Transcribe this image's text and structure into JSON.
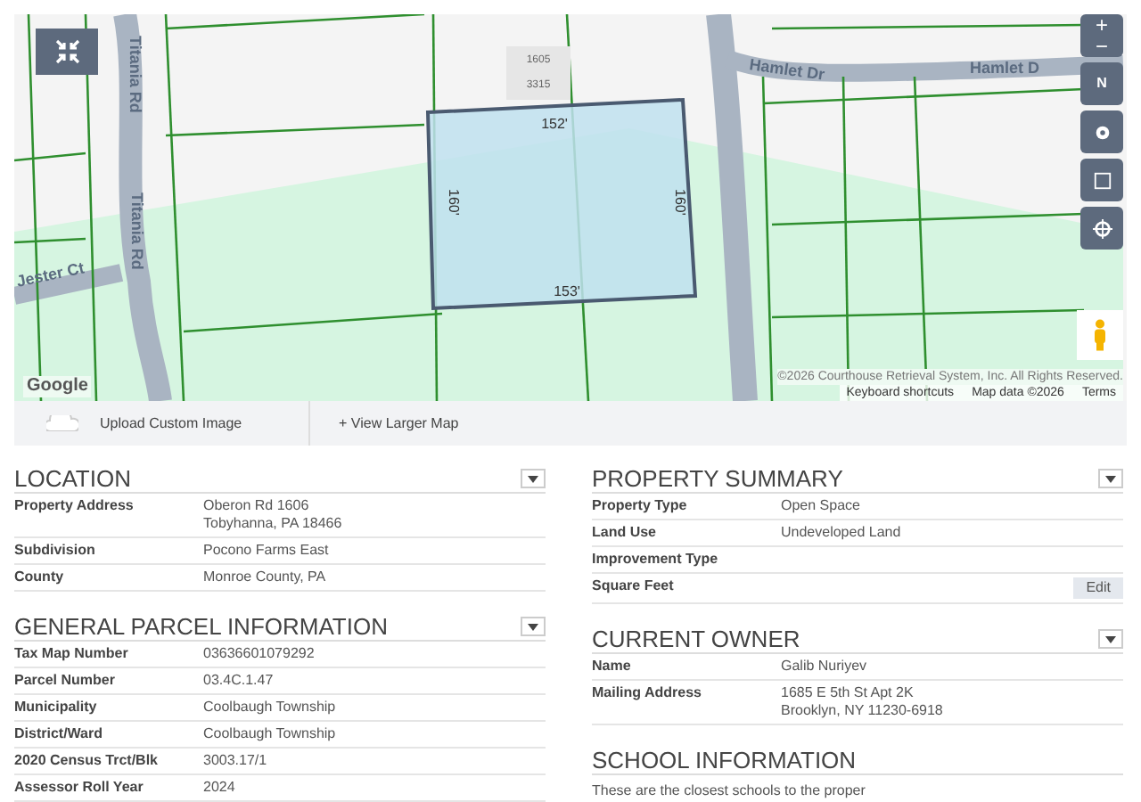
{
  "map": {
    "lot_numbers": [
      "1605",
      "3315"
    ],
    "roads": [
      {
        "name": "Titania Rd",
        "kind": "vertical"
      },
      {
        "name": "Titania Rd",
        "kind": "vertical-lower"
      },
      {
        "name": "Hamlet Dr",
        "kind": "horizontal"
      },
      {
        "name": "Hamlet D",
        "kind": "horizontal-right"
      },
      {
        "name": "Jester Ct",
        "kind": "diagonal"
      }
    ],
    "parcel": {
      "top": "152'",
      "left": "160'",
      "right": "160'",
      "bottom": "153'"
    },
    "controls": {
      "zoom_in": "+",
      "zoom_out": "−",
      "compass": "N"
    },
    "logo": "Google",
    "attribution": "©2026 Courthouse Retrieval System, Inc. All Rights Reserved.",
    "footer_links": [
      "Keyboard shortcuts",
      "Map data ©2026",
      "Terms"
    ]
  },
  "map_actions": [
    {
      "label": "Upload Custom Image",
      "kind": "upload"
    },
    {
      "label": "+ View Larger Map",
      "kind": "link"
    }
  ],
  "columns": [
    [
      {
        "title": "LOCATION",
        "rows": [
          {
            "label": "Property Address",
            "value": [
              "Oberon Rd 1606",
              "Tobyhanna, PA 18466"
            ]
          },
          {
            "label": "Subdivision",
            "value": [
              "Pocono Farms East"
            ]
          },
          {
            "label": "County",
            "value": [
              "Monroe County, PA"
            ]
          }
        ]
      },
      {
        "title": "GENERAL PARCEL INFORMATION",
        "rows": [
          {
            "label": "Tax Map Number",
            "value": [
              "03636601079292"
            ]
          },
          {
            "label": "Parcel Number",
            "value": [
              "03.4C.1.47"
            ]
          },
          {
            "label": "Municipality",
            "value": [
              "Coolbaugh Township"
            ]
          },
          {
            "label": "District/Ward",
            "value": [
              "Coolbaugh Township"
            ]
          },
          {
            "label": "2020 Census Trct/Blk",
            "value": [
              "3003.17/1"
            ]
          },
          {
            "label": "Assessor Roll Year",
            "value": [
              "2024"
            ]
          }
        ]
      }
    ],
    [
      {
        "title": "PROPERTY SUMMARY",
        "rows": [
          {
            "label": "Property Type",
            "value": [
              "Open Space"
            ]
          },
          {
            "label": "Land Use",
            "value": [
              "Undeveloped Land"
            ]
          },
          {
            "label": "Improvement Type",
            "value": []
          },
          {
            "label": "Square Feet",
            "value": [],
            "action": "Edit"
          }
        ]
      },
      {
        "title": "CURRENT OWNER",
        "rows": [
          {
            "label": "Name",
            "value": [
              "Galib Nuriyev"
            ]
          },
          {
            "label": "Mailing Address",
            "value": [
              "1685 E 5th St Apt 2K",
              "Brooklyn, NY 11230-6918"
            ]
          }
        ]
      },
      {
        "title": "SCHOOL INFORMATION",
        "note": "These are the closest schools to the proper"
      }
    ]
  ]
}
